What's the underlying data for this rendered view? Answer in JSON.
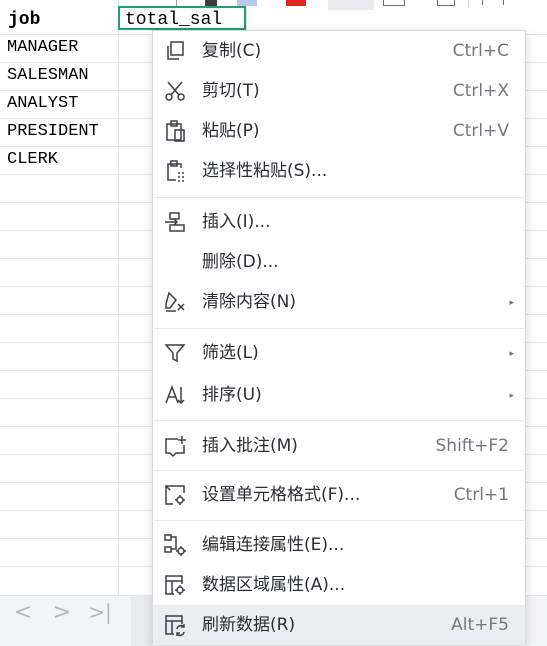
{
  "sheet": {
    "headers": [
      "job",
      "total_sal"
    ],
    "rows": [
      "MANAGER",
      "SALESMAN",
      "ANALYST",
      "PRESIDENT",
      "CLERK"
    ]
  },
  "navigation": {
    "prev": "<",
    "next": ">",
    "last": ">|"
  },
  "context_menu": {
    "items": [
      {
        "label": "复制(C)",
        "shortcut": "Ctrl+C",
        "icon": "copy-icon"
      },
      {
        "label": "剪切(T)",
        "shortcut": "Ctrl+X",
        "icon": "scissors-icon"
      },
      {
        "label": "粘贴(P)",
        "shortcut": "Ctrl+V",
        "icon": "clipboard-icon"
      },
      {
        "label": "选择性粘贴(S)...",
        "shortcut": "",
        "icon": "paste-special-icon"
      },
      {
        "label": "插入(I)...",
        "shortcut": "",
        "icon": "insert-icon"
      },
      {
        "label": "删除(D)...",
        "shortcut": "",
        "icon": ""
      },
      {
        "label": "清除内容(N)",
        "shortcut": "",
        "icon": "eraser-icon",
        "submenu": true
      },
      {
        "label": "筛选(L)",
        "shortcut": "",
        "icon": "filter-icon",
        "submenu": true
      },
      {
        "label": "排序(U)",
        "shortcut": "",
        "icon": "sort-icon",
        "submenu": true
      },
      {
        "label": "插入批注(M)",
        "shortcut": "Shift+F2",
        "icon": "comment-add-icon"
      },
      {
        "label": "设置单元格格式(F)...",
        "shortcut": "Ctrl+1",
        "icon": "format-cells-icon"
      },
      {
        "label": "编辑连接属性(E)...",
        "shortcut": "",
        "icon": "connection-settings-icon"
      },
      {
        "label": "数据区域属性(A)...",
        "shortcut": "",
        "icon": "data-range-icon"
      },
      {
        "label": "刷新数据(R)",
        "shortcut": "Alt+F5",
        "icon": "refresh-data-icon"
      }
    ],
    "submenu_arrow": "▸"
  }
}
